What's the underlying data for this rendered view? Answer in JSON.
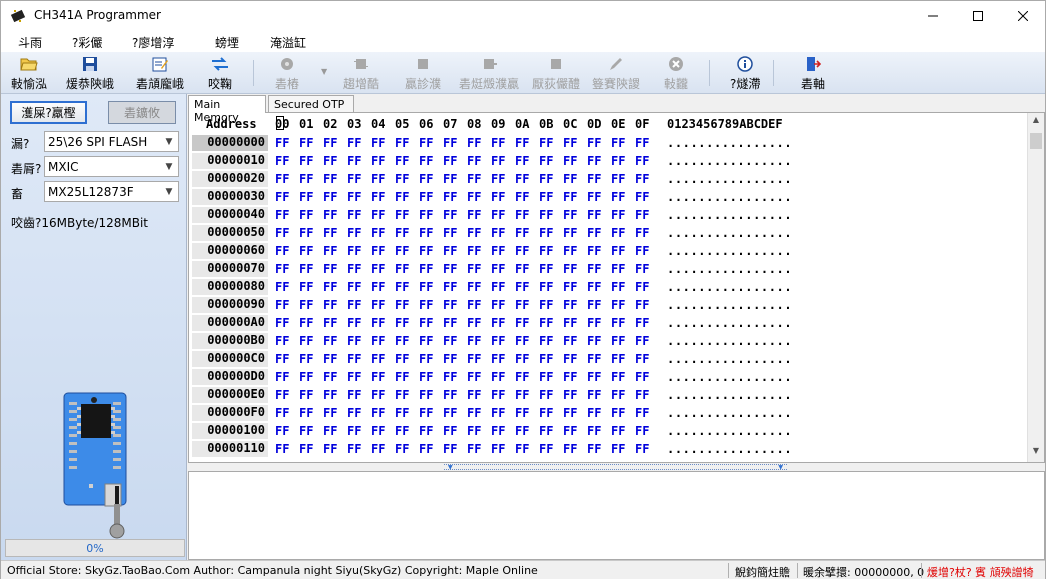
{
  "window": {
    "title": "CH341A Programmer"
  },
  "menu": [
    "斗雨",
    "?彩儼",
    "?廖增淳",
    "螃堙",
    "淹溢缸"
  ],
  "toolbar": [
    {
      "label": "軙愉泓",
      "icon": "folder-open-icon",
      "enabled": true
    },
    {
      "label": "煖恭陝峨",
      "icon": "floppy-save-icon",
      "enabled": true
    },
    {
      "label": "砉頏龐峨",
      "icon": "edit-note-icon",
      "enabled": true
    },
    {
      "label": "咬鞠",
      "icon": "swap-arrows-icon",
      "enabled": true
    },
    {
      "label": "砉樁",
      "icon": "gear-dropdown-icon",
      "enabled": false
    },
    {
      "label": "趨增酷",
      "icon": "chip-icon",
      "enabled": false
    },
    {
      "label": "贏診濮",
      "icon": "chip-icon",
      "enabled": false
    },
    {
      "label": "砉烶燬濮贏",
      "icon": "chip-arrow-icon",
      "enabled": false
    },
    {
      "label": "厭荻儼醴",
      "icon": "chip-icon",
      "enabled": false
    },
    {
      "label": "簦賽陝謖",
      "icon": "pencil-icon",
      "enabled": false
    },
    {
      "label": "軙龖",
      "icon": "stop-icon",
      "enabled": false
    },
    {
      "label": "?燧滯",
      "icon": "info-icon",
      "enabled": true
    },
    {
      "label": "砉軸",
      "icon": "exit-door-icon",
      "enabled": true
    }
  ],
  "left": {
    "detect_label": "濩屎?羸樫",
    "other_label": "砉鑛攸",
    "type_label": "漏?",
    "type_value": "25\\26 SPI FLASH",
    "maker_label": "砉脣?",
    "maker_value": "MXIC",
    "model_label": "畜",
    "model_value": "MX25L12873F",
    "capacity": "咬齒?16MByte/128MBit",
    "progress": "0%",
    "progress_value": 0
  },
  "tabs": [
    "Main Memory",
    "Secured OTP"
  ],
  "hex": {
    "address_header": "Address",
    "columns": [
      "00",
      "01",
      "02",
      "03",
      "04",
      "05",
      "06",
      "07",
      "08",
      "09",
      "0A",
      "0B",
      "0C",
      "0D",
      "0E",
      "0F"
    ],
    "ascii_header": "0123456789ABCDEF",
    "rows": [
      {
        "addr": "00000000",
        "bytes": [
          "FF",
          "FF",
          "FF",
          "FF",
          "FF",
          "FF",
          "FF",
          "FF",
          "FF",
          "FF",
          "FF",
          "FF",
          "FF",
          "FF",
          "FF",
          "FF"
        ],
        "ascii": "................"
      },
      {
        "addr": "00000010",
        "bytes": [
          "FF",
          "FF",
          "FF",
          "FF",
          "FF",
          "FF",
          "FF",
          "FF",
          "FF",
          "FF",
          "FF",
          "FF",
          "FF",
          "FF",
          "FF",
          "FF"
        ],
        "ascii": "................"
      },
      {
        "addr": "00000020",
        "bytes": [
          "FF",
          "FF",
          "FF",
          "FF",
          "FF",
          "FF",
          "FF",
          "FF",
          "FF",
          "FF",
          "FF",
          "FF",
          "FF",
          "FF",
          "FF",
          "FF"
        ],
        "ascii": "................"
      },
      {
        "addr": "00000030",
        "bytes": [
          "FF",
          "FF",
          "FF",
          "FF",
          "FF",
          "FF",
          "FF",
          "FF",
          "FF",
          "FF",
          "FF",
          "FF",
          "FF",
          "FF",
          "FF",
          "FF"
        ],
        "ascii": "................"
      },
      {
        "addr": "00000040",
        "bytes": [
          "FF",
          "FF",
          "FF",
          "FF",
          "FF",
          "FF",
          "FF",
          "FF",
          "FF",
          "FF",
          "FF",
          "FF",
          "FF",
          "FF",
          "FF",
          "FF"
        ],
        "ascii": "................"
      },
      {
        "addr": "00000050",
        "bytes": [
          "FF",
          "FF",
          "FF",
          "FF",
          "FF",
          "FF",
          "FF",
          "FF",
          "FF",
          "FF",
          "FF",
          "FF",
          "FF",
          "FF",
          "FF",
          "FF"
        ],
        "ascii": "................"
      },
      {
        "addr": "00000060",
        "bytes": [
          "FF",
          "FF",
          "FF",
          "FF",
          "FF",
          "FF",
          "FF",
          "FF",
          "FF",
          "FF",
          "FF",
          "FF",
          "FF",
          "FF",
          "FF",
          "FF"
        ],
        "ascii": "................"
      },
      {
        "addr": "00000070",
        "bytes": [
          "FF",
          "FF",
          "FF",
          "FF",
          "FF",
          "FF",
          "FF",
          "FF",
          "FF",
          "FF",
          "FF",
          "FF",
          "FF",
          "FF",
          "FF",
          "FF"
        ],
        "ascii": "................"
      },
      {
        "addr": "00000080",
        "bytes": [
          "FF",
          "FF",
          "FF",
          "FF",
          "FF",
          "FF",
          "FF",
          "FF",
          "FF",
          "FF",
          "FF",
          "FF",
          "FF",
          "FF",
          "FF",
          "FF"
        ],
        "ascii": "................"
      },
      {
        "addr": "00000090",
        "bytes": [
          "FF",
          "FF",
          "FF",
          "FF",
          "FF",
          "FF",
          "FF",
          "FF",
          "FF",
          "FF",
          "FF",
          "FF",
          "FF",
          "FF",
          "FF",
          "FF"
        ],
        "ascii": "................"
      },
      {
        "addr": "000000A0",
        "bytes": [
          "FF",
          "FF",
          "FF",
          "FF",
          "FF",
          "FF",
          "FF",
          "FF",
          "FF",
          "FF",
          "FF",
          "FF",
          "FF",
          "FF",
          "FF",
          "FF"
        ],
        "ascii": "................"
      },
      {
        "addr": "000000B0",
        "bytes": [
          "FF",
          "FF",
          "FF",
          "FF",
          "FF",
          "FF",
          "FF",
          "FF",
          "FF",
          "FF",
          "FF",
          "FF",
          "FF",
          "FF",
          "FF",
          "FF"
        ],
        "ascii": "................"
      },
      {
        "addr": "000000C0",
        "bytes": [
          "FF",
          "FF",
          "FF",
          "FF",
          "FF",
          "FF",
          "FF",
          "FF",
          "FF",
          "FF",
          "FF",
          "FF",
          "FF",
          "FF",
          "FF",
          "FF"
        ],
        "ascii": "................"
      },
      {
        "addr": "000000D0",
        "bytes": [
          "FF",
          "FF",
          "FF",
          "FF",
          "FF",
          "FF",
          "FF",
          "FF",
          "FF",
          "FF",
          "FF",
          "FF",
          "FF",
          "FF",
          "FF",
          "FF"
        ],
        "ascii": "................"
      },
      {
        "addr": "000000E0",
        "bytes": [
          "FF",
          "FF",
          "FF",
          "FF",
          "FF",
          "FF",
          "FF",
          "FF",
          "FF",
          "FF",
          "FF",
          "FF",
          "FF",
          "FF",
          "FF",
          "FF"
        ],
        "ascii": "................"
      },
      {
        "addr": "000000F0",
        "bytes": [
          "FF",
          "FF",
          "FF",
          "FF",
          "FF",
          "FF",
          "FF",
          "FF",
          "FF",
          "FF",
          "FF",
          "FF",
          "FF",
          "FF",
          "FF",
          "FF"
        ],
        "ascii": "................"
      },
      {
        "addr": "00000100",
        "bytes": [
          "FF",
          "FF",
          "FF",
          "FF",
          "FF",
          "FF",
          "FF",
          "FF",
          "FF",
          "FF",
          "FF",
          "FF",
          "FF",
          "FF",
          "FF",
          "FF"
        ],
        "ascii": "................"
      },
      {
        "addr": "00000110",
        "bytes": [
          "FF",
          "FF",
          "FF",
          "FF",
          "FF",
          "FF",
          "FF",
          "FF",
          "FF",
          "FF",
          "FF",
          "FF",
          "FF",
          "FF",
          "FF",
          "FF"
        ],
        "ascii": "................"
      }
    ]
  },
  "status": {
    "credits": "Official Store: SkyGz.TaoBao.Com Author: Campanula night Siyu(SkyGz) Copyright: Maple Online",
    "state": "觬鈞簡炷贍",
    "offset": "暖余擘擐: 00000000, 0",
    "warning": "煖增?杖? 賓 頏殃譄犄",
    "warning_color": "#e00000"
  }
}
